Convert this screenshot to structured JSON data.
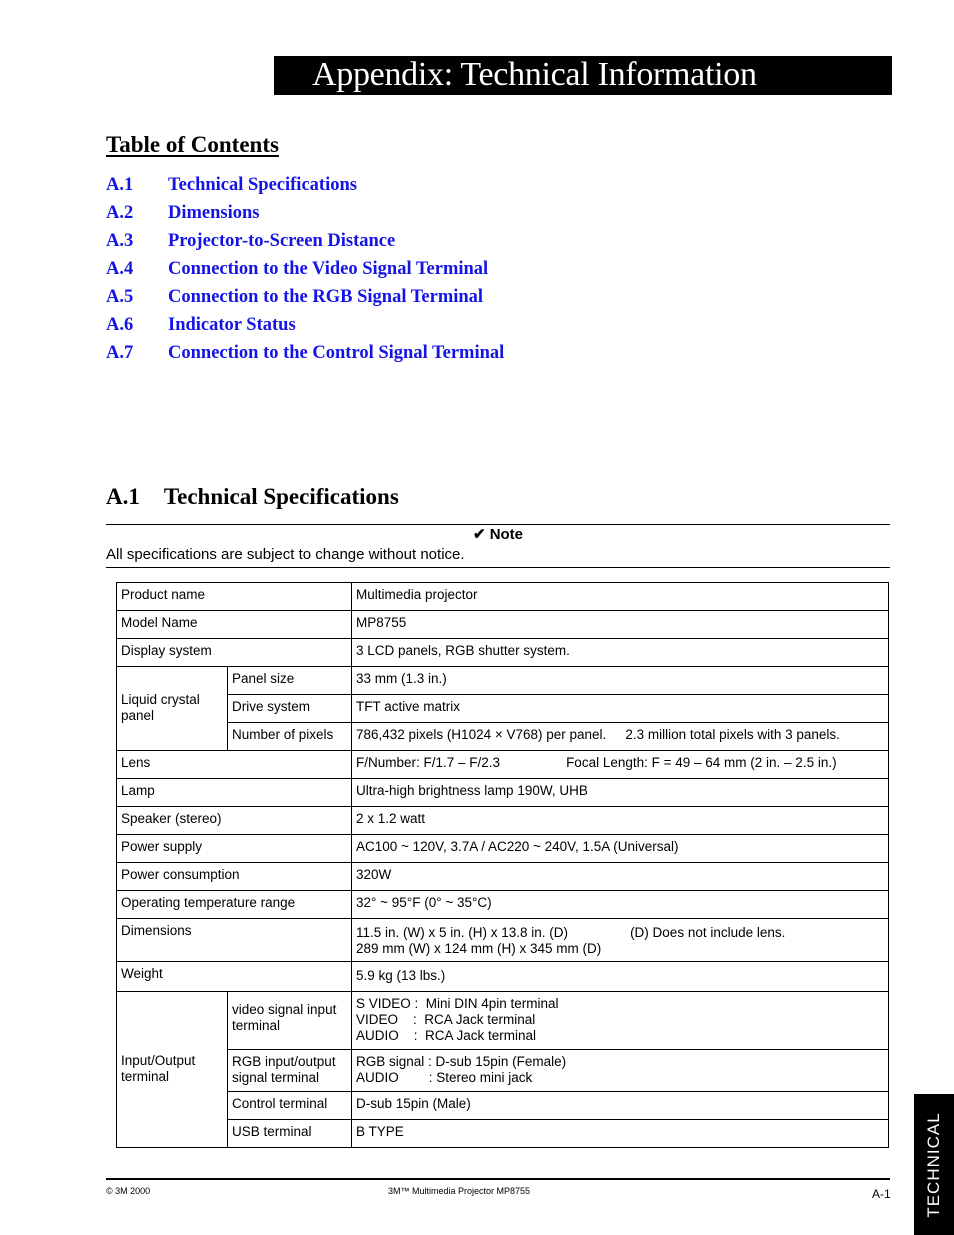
{
  "page_title": "Appendix:  Technical Information",
  "toc": {
    "heading": "Table of Contents",
    "items": [
      {
        "num": "A.1",
        "label": "Technical Specifications"
      },
      {
        "num": "A.2",
        "label": "Dimensions"
      },
      {
        "num": "A.3",
        "label": "Projector-to-Screen Distance"
      },
      {
        "num": "A.4",
        "label": "Connection to the Video Signal Terminal"
      },
      {
        "num": "A.5",
        "label": "Connection to the RGB Signal Terminal"
      },
      {
        "num": "A.6",
        "label": "Indicator Status"
      },
      {
        "num": "A.7",
        "label": "Connection to the Control Signal Terminal"
      }
    ],
    "link_color": "#1414e6"
  },
  "section": {
    "num": "A.1",
    "title": "Technical Specifications",
    "note_title": "✔ Note",
    "note_text": "All specifications are subject to change without notice."
  },
  "specs": {
    "product_name": {
      "label": "Product name",
      "value": "Multimedia projector"
    },
    "model_name": {
      "label": "Model Name",
      "value": "MP8755"
    },
    "display_system": {
      "label": "Display system",
      "value": "3 LCD panels, RGB shutter system."
    },
    "lcd_panel": {
      "label": "Liquid crystal panel",
      "panel_size": {
        "label": "Panel size",
        "value": "33 mm (1.3 in.)"
      },
      "drive_system": {
        "label": "Drive system",
        "value": "TFT active matrix"
      },
      "pixels": {
        "label": "Number of pixels",
        "value": "786,432 pixels (H1024 × V768) per panel.",
        "value2": "2.3 million total pixels with 3 panels."
      }
    },
    "lens": {
      "label": "Lens",
      "value": "F/Number:  F/1.7 – F/2.3",
      "value2": "Focal Length:  F = 49 – 64 mm  (2 in. – 2.5 in.)"
    },
    "lamp": {
      "label": "Lamp",
      "value": "Ultra-high brightness lamp 190W, UHB"
    },
    "speaker": {
      "label": "Speaker (stereo)",
      "value": "2 x 1.2 watt"
    },
    "power_supply": {
      "label": "Power supply",
      "value": "AC100 ~ 120V, 3.7A / AC220 ~ 240V, 1.5A (Universal)"
    },
    "power_consumption": {
      "label": "Power consumption",
      "value": "320W"
    },
    "temperature": {
      "label": "Operating temperature range",
      "value": "32° ~ 95°F  (0° ~ 35°C)"
    },
    "dimensions": {
      "label": "Dimensions",
      "line1": "11.5 in. (W) x 5 in. (H) x 13.8 in. (D)",
      "note": "(D) Does not include lens.",
      "line2": "289 mm (W) x 124 mm (H) x 345 mm (D)"
    },
    "weight": {
      "label": "Weight",
      "value": "5.9 kg (13 lbs.)"
    },
    "io": {
      "label": "Input/Output terminal",
      "video": {
        "label": "video signal input terminal",
        "lines": [
          "S VIDEO :  Mini DIN 4pin terminal",
          "VIDEO    :  RCA Jack terminal",
          "AUDIO    :  RCA Jack terminal"
        ]
      },
      "rgb": {
        "label": "RGB input/output signal terminal",
        "lines": [
          "RGB signal : D-sub 15pin (Female)",
          "AUDIO        : Stereo mini jack"
        ]
      },
      "control": {
        "label": "Control terminal",
        "value": "D-sub 15pin (Male)"
      },
      "usb": {
        "label": "USB terminal",
        "value": "B TYPE"
      }
    }
  },
  "footer": {
    "copyright": "© 3M 2000",
    "product": "3M™ Multimedia Projector MP8755",
    "page": "A-1"
  },
  "side_tab": "TECHNICAL"
}
